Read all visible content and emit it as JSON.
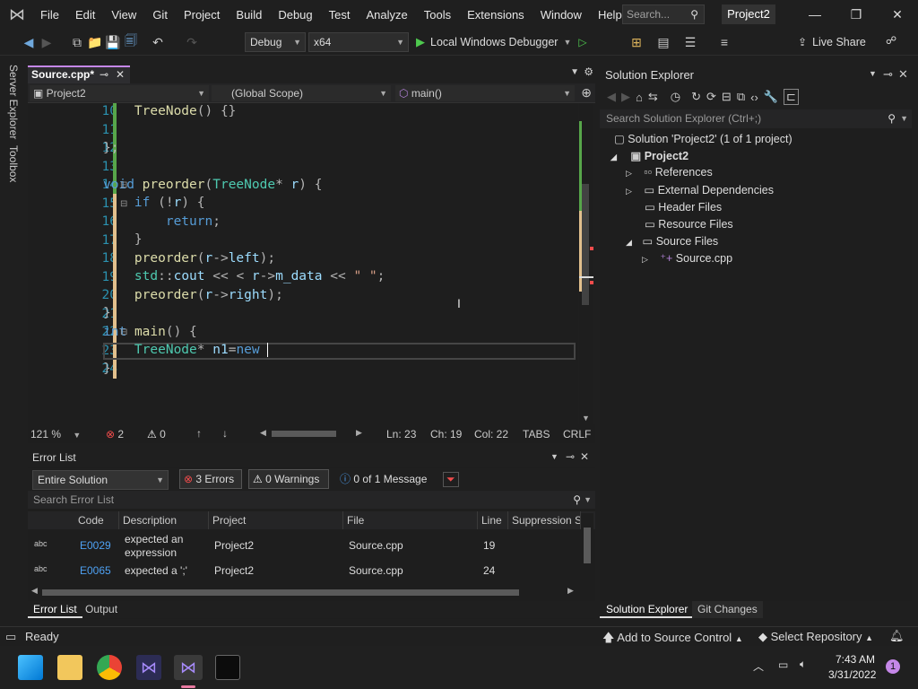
{
  "titlebar": {
    "menus": [
      "File",
      "Edit",
      "View",
      "Git",
      "Project",
      "Build",
      "Debug",
      "Test",
      "Analyze",
      "Tools",
      "Extensions",
      "Window",
      "Help"
    ],
    "search_placeholder": "Search...",
    "project_name": "Project2"
  },
  "toolbar": {
    "config": "Debug",
    "platform": "x64",
    "run_label": "Local Windows Debugger",
    "live_share": "Live Share"
  },
  "leftstrip": {
    "server_explorer": "Server Explorer",
    "toolbox": "Toolbox"
  },
  "editor": {
    "tab_label": "Source.cpp*",
    "nav_project": "Project2",
    "nav_scope": "(Global Scope)",
    "nav_member": "main()",
    "line_numbers": [
      "10",
      "11",
      "12",
      "13",
      "14",
      "15",
      "16",
      "17",
      "18",
      "19",
      "20",
      "21",
      "22",
      "23",
      "24"
    ],
    "zoom": "121 %",
    "errors": "2",
    "warnings": "0",
    "ln": "Ln: 23",
    "ch": "Ch: 19",
    "col": "Col: 22",
    "tabs": "TABS",
    "crlf": "CRLF"
  },
  "error_list": {
    "title": "Error List",
    "scope": "Entire Solution",
    "errors_btn": "3 Errors",
    "warnings_btn": "0 Warnings",
    "messages_btn": "0 of 1 Message",
    "search_placeholder": "Search Error List",
    "columns": [
      "Code",
      "Description",
      "Project",
      "File",
      "Line",
      "Suppression S"
    ],
    "rows": [
      {
        "code": "E0029",
        "desc1": "expected an",
        "desc2": "expression",
        "project": "Project2",
        "file": "Source.cpp",
        "line": "19"
      },
      {
        "code": "E0065",
        "desc1": "expected a ';'",
        "desc2": "",
        "project": "Project2",
        "file": "Source.cpp",
        "line": "24"
      }
    ],
    "tab_errors": "Error List",
    "tab_output": "Output"
  },
  "solution_explorer": {
    "title": "Solution Explorer",
    "search_placeholder": "Search Solution Explorer (Ctrl+;)",
    "solution": "Solution 'Project2' (1 of 1 project)",
    "project": "Project2",
    "references": "References",
    "external": "External Dependencies",
    "header": "Header Files",
    "resource": "Resource Files",
    "source": "Source Files",
    "file": "Source.cpp",
    "tab_se": "Solution Explorer",
    "tab_git": "Git Changes"
  },
  "statusbar": {
    "ready": "Ready",
    "add_source": "Add to Source Control",
    "select_repo": "Select Repository"
  },
  "taskbar": {
    "time": "7:43 AM",
    "date": "3/31/2022",
    "notif": "1"
  }
}
